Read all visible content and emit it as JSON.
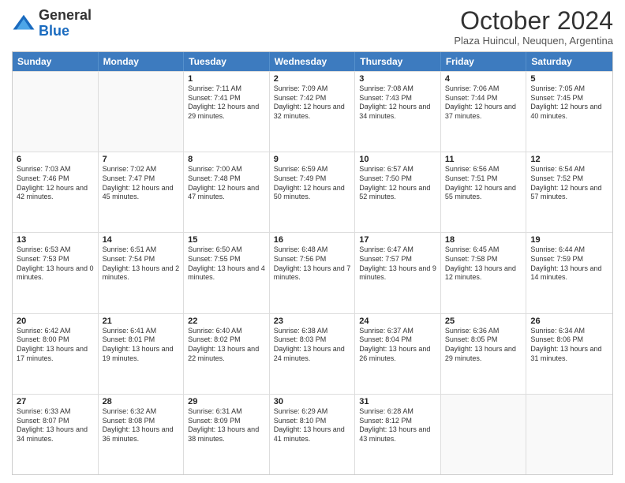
{
  "header": {
    "logo_general": "General",
    "logo_blue": "Blue",
    "month_title": "October 2024",
    "subtitle": "Plaza Huincul, Neuquen, Argentina"
  },
  "days_of_week": [
    "Sunday",
    "Monday",
    "Tuesday",
    "Wednesday",
    "Thursday",
    "Friday",
    "Saturday"
  ],
  "weeks": [
    [
      {
        "day": "",
        "empty": true
      },
      {
        "day": "",
        "empty": true
      },
      {
        "day": "1",
        "sunrise": "Sunrise: 7:11 AM",
        "sunset": "Sunset: 7:41 PM",
        "daylight": "Daylight: 12 hours and 29 minutes."
      },
      {
        "day": "2",
        "sunrise": "Sunrise: 7:09 AM",
        "sunset": "Sunset: 7:42 PM",
        "daylight": "Daylight: 12 hours and 32 minutes."
      },
      {
        "day": "3",
        "sunrise": "Sunrise: 7:08 AM",
        "sunset": "Sunset: 7:43 PM",
        "daylight": "Daylight: 12 hours and 34 minutes."
      },
      {
        "day": "4",
        "sunrise": "Sunrise: 7:06 AM",
        "sunset": "Sunset: 7:44 PM",
        "daylight": "Daylight: 12 hours and 37 minutes."
      },
      {
        "day": "5",
        "sunrise": "Sunrise: 7:05 AM",
        "sunset": "Sunset: 7:45 PM",
        "daylight": "Daylight: 12 hours and 40 minutes."
      }
    ],
    [
      {
        "day": "6",
        "sunrise": "Sunrise: 7:03 AM",
        "sunset": "Sunset: 7:46 PM",
        "daylight": "Daylight: 12 hours and 42 minutes."
      },
      {
        "day": "7",
        "sunrise": "Sunrise: 7:02 AM",
        "sunset": "Sunset: 7:47 PM",
        "daylight": "Daylight: 12 hours and 45 minutes."
      },
      {
        "day": "8",
        "sunrise": "Sunrise: 7:00 AM",
        "sunset": "Sunset: 7:48 PM",
        "daylight": "Daylight: 12 hours and 47 minutes."
      },
      {
        "day": "9",
        "sunrise": "Sunrise: 6:59 AM",
        "sunset": "Sunset: 7:49 PM",
        "daylight": "Daylight: 12 hours and 50 minutes."
      },
      {
        "day": "10",
        "sunrise": "Sunrise: 6:57 AM",
        "sunset": "Sunset: 7:50 PM",
        "daylight": "Daylight: 12 hours and 52 minutes."
      },
      {
        "day": "11",
        "sunrise": "Sunrise: 6:56 AM",
        "sunset": "Sunset: 7:51 PM",
        "daylight": "Daylight: 12 hours and 55 minutes."
      },
      {
        "day": "12",
        "sunrise": "Sunrise: 6:54 AM",
        "sunset": "Sunset: 7:52 PM",
        "daylight": "Daylight: 12 hours and 57 minutes."
      }
    ],
    [
      {
        "day": "13",
        "sunrise": "Sunrise: 6:53 AM",
        "sunset": "Sunset: 7:53 PM",
        "daylight": "Daylight: 13 hours and 0 minutes."
      },
      {
        "day": "14",
        "sunrise": "Sunrise: 6:51 AM",
        "sunset": "Sunset: 7:54 PM",
        "daylight": "Daylight: 13 hours and 2 minutes."
      },
      {
        "day": "15",
        "sunrise": "Sunrise: 6:50 AM",
        "sunset": "Sunset: 7:55 PM",
        "daylight": "Daylight: 13 hours and 4 minutes."
      },
      {
        "day": "16",
        "sunrise": "Sunrise: 6:48 AM",
        "sunset": "Sunset: 7:56 PM",
        "daylight": "Daylight: 13 hours and 7 minutes."
      },
      {
        "day": "17",
        "sunrise": "Sunrise: 6:47 AM",
        "sunset": "Sunset: 7:57 PM",
        "daylight": "Daylight: 13 hours and 9 minutes."
      },
      {
        "day": "18",
        "sunrise": "Sunrise: 6:45 AM",
        "sunset": "Sunset: 7:58 PM",
        "daylight": "Daylight: 13 hours and 12 minutes."
      },
      {
        "day": "19",
        "sunrise": "Sunrise: 6:44 AM",
        "sunset": "Sunset: 7:59 PM",
        "daylight": "Daylight: 13 hours and 14 minutes."
      }
    ],
    [
      {
        "day": "20",
        "sunrise": "Sunrise: 6:42 AM",
        "sunset": "Sunset: 8:00 PM",
        "daylight": "Daylight: 13 hours and 17 minutes."
      },
      {
        "day": "21",
        "sunrise": "Sunrise: 6:41 AM",
        "sunset": "Sunset: 8:01 PM",
        "daylight": "Daylight: 13 hours and 19 minutes."
      },
      {
        "day": "22",
        "sunrise": "Sunrise: 6:40 AM",
        "sunset": "Sunset: 8:02 PM",
        "daylight": "Daylight: 13 hours and 22 minutes."
      },
      {
        "day": "23",
        "sunrise": "Sunrise: 6:38 AM",
        "sunset": "Sunset: 8:03 PM",
        "daylight": "Daylight: 13 hours and 24 minutes."
      },
      {
        "day": "24",
        "sunrise": "Sunrise: 6:37 AM",
        "sunset": "Sunset: 8:04 PM",
        "daylight": "Daylight: 13 hours and 26 minutes."
      },
      {
        "day": "25",
        "sunrise": "Sunrise: 6:36 AM",
        "sunset": "Sunset: 8:05 PM",
        "daylight": "Daylight: 13 hours and 29 minutes."
      },
      {
        "day": "26",
        "sunrise": "Sunrise: 6:34 AM",
        "sunset": "Sunset: 8:06 PM",
        "daylight": "Daylight: 13 hours and 31 minutes."
      }
    ],
    [
      {
        "day": "27",
        "sunrise": "Sunrise: 6:33 AM",
        "sunset": "Sunset: 8:07 PM",
        "daylight": "Daylight: 13 hours and 34 minutes."
      },
      {
        "day": "28",
        "sunrise": "Sunrise: 6:32 AM",
        "sunset": "Sunset: 8:08 PM",
        "daylight": "Daylight: 13 hours and 36 minutes."
      },
      {
        "day": "29",
        "sunrise": "Sunrise: 6:31 AM",
        "sunset": "Sunset: 8:09 PM",
        "daylight": "Daylight: 13 hours and 38 minutes."
      },
      {
        "day": "30",
        "sunrise": "Sunrise: 6:29 AM",
        "sunset": "Sunset: 8:10 PM",
        "daylight": "Daylight: 13 hours and 41 minutes."
      },
      {
        "day": "31",
        "sunrise": "Sunrise: 6:28 AM",
        "sunset": "Sunset: 8:12 PM",
        "daylight": "Daylight: 13 hours and 43 minutes."
      },
      {
        "day": "",
        "empty": true
      },
      {
        "day": "",
        "empty": true
      }
    ]
  ]
}
